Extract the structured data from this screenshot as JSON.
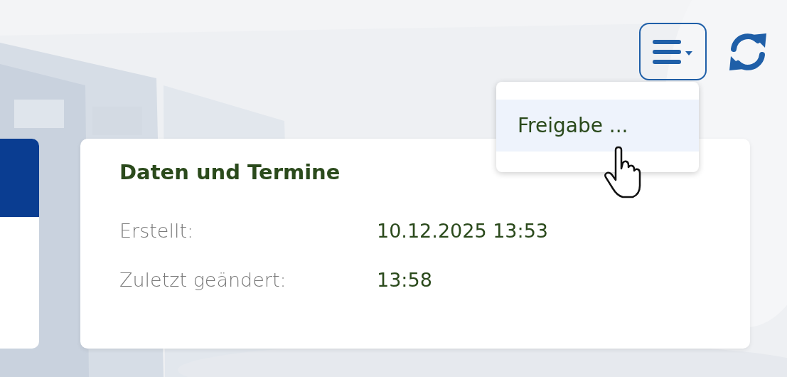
{
  "toolbar": {
    "menu_button": {
      "expanded": true
    }
  },
  "menu": {
    "items": [
      {
        "label": "Freigabe ...",
        "highlighted": true
      }
    ]
  },
  "card": {
    "title": "Daten und Termine",
    "rows": [
      {
        "label": "Erstellt:",
        "value": "10.12.2025 13:53"
      },
      {
        "label": "Zuletzt geändert:",
        "value": "13:58"
      }
    ]
  }
}
